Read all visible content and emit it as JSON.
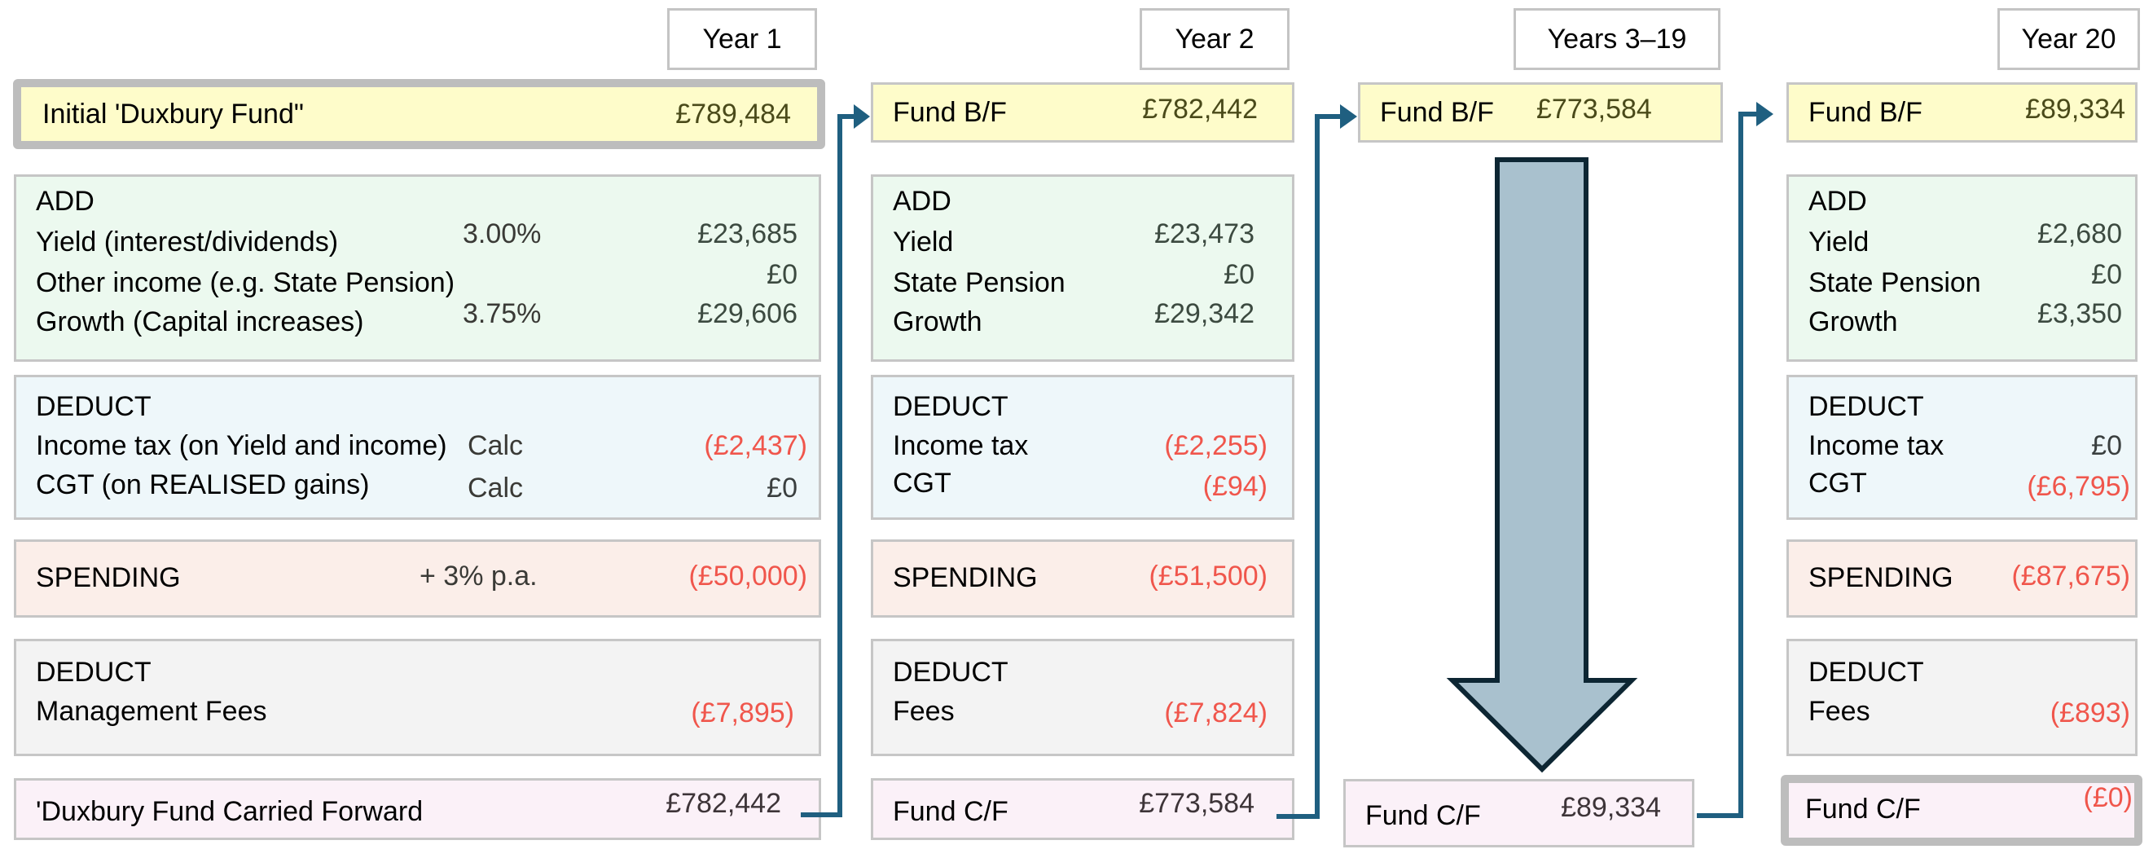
{
  "colors": {
    "connector": "#1f5f80",
    "big_arrow_fill": "#a9c1ce",
    "big_arrow_stroke": "#0d2633",
    "negative_value": "#f0564c",
    "fund_box": "#fefcca",
    "add_box": "#ecf9ef",
    "tax_box": "#eef7fa",
    "spending_box": "#fbeee9",
    "fees_box": "#f3f3f3",
    "carried_forward_box": "#fbf1f8"
  },
  "columns": {
    "year1": {
      "header": "Year 1",
      "fund_bf": {
        "label": "Initial 'Duxbury Fund\"",
        "value": "£789,484"
      },
      "add": {
        "title": "ADD",
        "yield": {
          "label": "Yield (interest/dividends)",
          "rate": "3.00%",
          "value": "£23,685"
        },
        "other_income": {
          "label": "Other income (e.g. State Pension)",
          "value": "£0"
        },
        "growth": {
          "label": "Growth (Capital increases)",
          "rate": "3.75%",
          "value": "£29,606"
        }
      },
      "deduct_tax": {
        "title": "DEDUCT",
        "income_tax": {
          "label": "Income tax (on Yield and income)",
          "note": "Calc",
          "value": "(£2,437)"
        },
        "cgt": {
          "label": "CGT (on REALISED gains)",
          "note": "Calc",
          "value": "£0"
        }
      },
      "spending": {
        "label": "SPENDING",
        "note": "+ 3% p.a.",
        "value": "(£50,000)"
      },
      "deduct_fees": {
        "title": "DEDUCT",
        "fees": {
          "label": "Management Fees",
          "value": "(£7,895)"
        }
      },
      "fund_cf": {
        "label": "'Duxbury Fund Carried Forward",
        "value": "£782,442"
      }
    },
    "year2": {
      "header": "Year 2",
      "fund_bf": {
        "label": "Fund B/F",
        "value": "£782,442"
      },
      "add": {
        "title": "ADD",
        "yield": {
          "label": "Yield",
          "value": "£23,473"
        },
        "other_income": {
          "label": "State Pension",
          "value": "£0"
        },
        "growth": {
          "label": "Growth",
          "value": "£29,342"
        }
      },
      "deduct_tax": {
        "title": "DEDUCT",
        "income_tax": {
          "label": "Income tax",
          "value": "(£2,255)"
        },
        "cgt": {
          "label": "CGT",
          "value": "(£94)"
        }
      },
      "spending": {
        "label": "SPENDING",
        "value": "(£51,500)"
      },
      "deduct_fees": {
        "title": "DEDUCT",
        "fees": {
          "label": "Fees",
          "value": "(£7,824)"
        }
      },
      "fund_cf": {
        "label": "Fund C/F",
        "value": "£773,584"
      }
    },
    "years3_19": {
      "header": "Years 3–19",
      "fund_bf": {
        "label": "Fund B/F",
        "value": "£773,584"
      },
      "fund_cf": {
        "label": "Fund C/F",
        "value": "£89,334"
      }
    },
    "year20": {
      "header": "Year 20",
      "fund_bf": {
        "label": "Fund B/F",
        "value": "£89,334"
      },
      "add": {
        "title": "ADD",
        "yield": {
          "label": "Yield",
          "value": "£2,680"
        },
        "other_income": {
          "label": "State Pension",
          "value": "£0"
        },
        "growth": {
          "label": "Growth",
          "value": "£3,350"
        }
      },
      "deduct_tax": {
        "title": "DEDUCT",
        "income_tax": {
          "label": "Income tax",
          "value": "£0"
        },
        "cgt": {
          "label": "CGT",
          "value": "(£6,795)"
        }
      },
      "spending": {
        "label": "SPENDING",
        "value": "(£87,675)"
      },
      "deduct_fees": {
        "title": "DEDUCT",
        "fees": {
          "label": "Fees",
          "value": "(£893)"
        }
      },
      "fund_cf": {
        "label": "Fund C/F",
        "value": "(£0)"
      }
    }
  }
}
